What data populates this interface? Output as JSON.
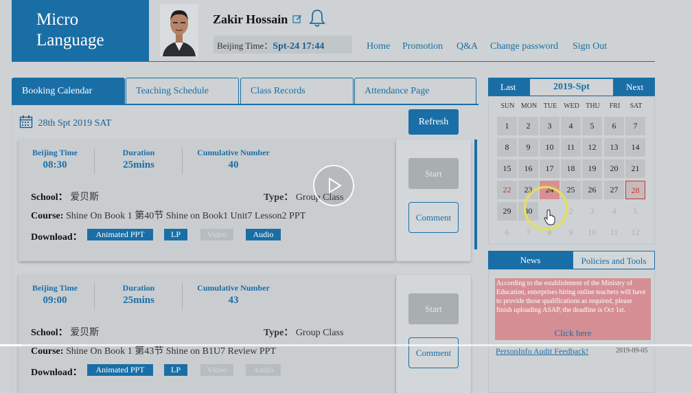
{
  "app": {
    "logo_line1": "Micro",
    "logo_line2": "Language"
  },
  "user": {
    "name": "Zakir Hossain",
    "time_label": "Beijing Time：",
    "time_value": "Spt-24 17:44"
  },
  "nav": [
    "Home",
    "Promotion",
    "Q&A",
    "Change password",
    "Sign Out"
  ],
  "tabs": [
    "Booking Calendar",
    "Teaching Schedule",
    "Class Records",
    "Attendance Page"
  ],
  "booking": {
    "date": "28th Spt 2019 SAT",
    "refresh": "Refresh",
    "lessons": [
      {
        "time_label": "Beijing Time",
        "time": "08:30",
        "duration_label": "Duration",
        "duration": "25mins",
        "cumulative_label": "Cumulative Number",
        "cumulative": "40",
        "school_label": "School：",
        "school": "爱贝斯",
        "type_label": "Type：",
        "type": "Group Class",
        "course_label": "Course:",
        "course": "Shine On Book 1 第40节 Shine on Book1 Unit7 Lesson2 PPT",
        "download_label": "Download：",
        "downloads": [
          "Animated PPT",
          "LP",
          "Video",
          "Audio"
        ],
        "start": "Start",
        "comment": "Comment"
      },
      {
        "time_label": "Beijing Time",
        "time": "09:00",
        "duration_label": "Duration",
        "duration": "25mins",
        "cumulative_label": "Cumulative Number",
        "cumulative": "43",
        "school_label": "School：",
        "school": "爱贝斯",
        "type_label": "Type：",
        "type": "Group Class",
        "course_label": "Course:",
        "course": "Shine On Book 1 第43节 Shine on B1U7 Review PPT",
        "download_label": "Download：",
        "downloads": [
          "Animated PPT",
          "LP",
          "Video",
          "Audio"
        ],
        "start": "Start",
        "comment": "Comment"
      }
    ]
  },
  "calendar": {
    "last": "Last",
    "title": "2019-Spt",
    "next": "Next",
    "weekdays": [
      "SUN",
      "MON",
      "TUE",
      "WED",
      "THU",
      "FRI",
      "SAT"
    ],
    "rows": [
      [
        "1",
        "2",
        "3",
        "4",
        "5",
        "6",
        "7"
      ],
      [
        "8",
        "9",
        "10",
        "11",
        "12",
        "13",
        "14"
      ],
      [
        "15",
        "16",
        "17",
        "18",
        "19",
        "20",
        "21"
      ],
      [
        "22",
        "23",
        "24",
        "25",
        "26",
        "27",
        "28"
      ],
      [
        "29",
        "30",
        "1",
        "2",
        "3",
        "4",
        "5"
      ],
      [
        "6",
        "7",
        "8",
        "9",
        "10",
        "11",
        "12"
      ]
    ]
  },
  "news": {
    "tab_news": "News",
    "tab_policies": "Policies and Tools",
    "notice": "According to the establishment of the Ministry of Education, enterprises hiring online teachers will have to provide those qualifications as required, please finish uploading ASAP, the deadline is Oct 1st.",
    "click_here": "Click here",
    "feedback": "PersonInfo Audit Feedback!",
    "feedback_date": "2019-09-05"
  },
  "colors": {
    "brand": "#1a6ea6",
    "highlight": "#d58f94"
  }
}
